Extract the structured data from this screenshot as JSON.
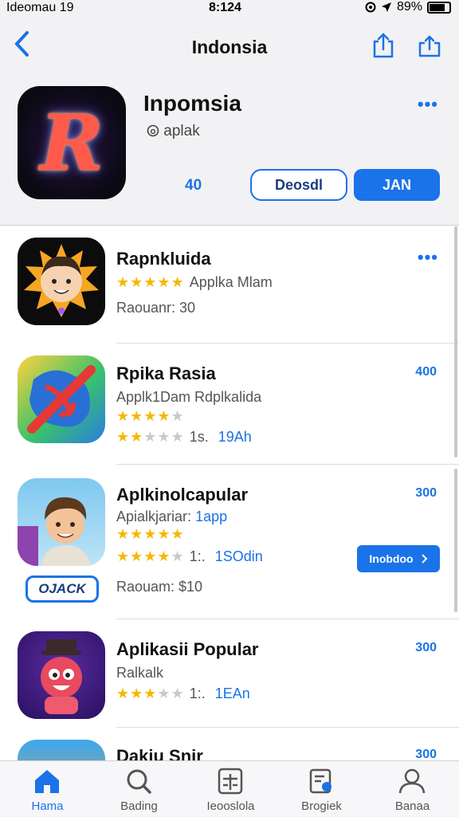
{
  "status_bar": {
    "left": "Ideomau 19",
    "time": "8:124",
    "battery": "89%"
  },
  "nav": {
    "title": "Indonsia"
  },
  "hero": {
    "app_name": "Inpomsia",
    "subtitle": "aplak",
    "mini_label": "40",
    "outline_button": "Deosdl",
    "fill_button": "JAN",
    "more": "•••"
  },
  "apps": [
    {
      "name": "Rapnkluida",
      "line1": "Applka Mlam",
      "stars": 5,
      "meta": "Raouanr: 30",
      "action": "•••"
    },
    {
      "name": "Rpika Rasia",
      "line1": "Applk1Dam Rdplkalida",
      "stars_a": 4,
      "stars_b": 2,
      "tail": "1s.",
      "tail_blue": "19Ah",
      "price": "400"
    },
    {
      "name": "Aplkinolcapular",
      "line1": "Apialkjariar:",
      "line1_blue": "1app",
      "stars_a": 5,
      "stars_b": 4,
      "tail": "1:.",
      "tail_blue": "1SOdin",
      "meta": "Raouam: $10",
      "price": "300",
      "button": "Inobdoo",
      "badge": "OJACK"
    },
    {
      "name": "Aplikasii Popular",
      "line1": "Ralkalk",
      "stars_b": 3,
      "tail": "1:.",
      "tail_blue": "1EAn",
      "price": "300"
    },
    {
      "name": "Dakiu Snir",
      "price": "300"
    }
  ],
  "tabs": [
    {
      "label": "Hama"
    },
    {
      "label": "Bading"
    },
    {
      "label": "Ieooslola"
    },
    {
      "label": "Brogiek"
    },
    {
      "label": "Banaa"
    }
  ],
  "colors": {
    "accent": "#1a73e8",
    "star": "#f5b800"
  }
}
